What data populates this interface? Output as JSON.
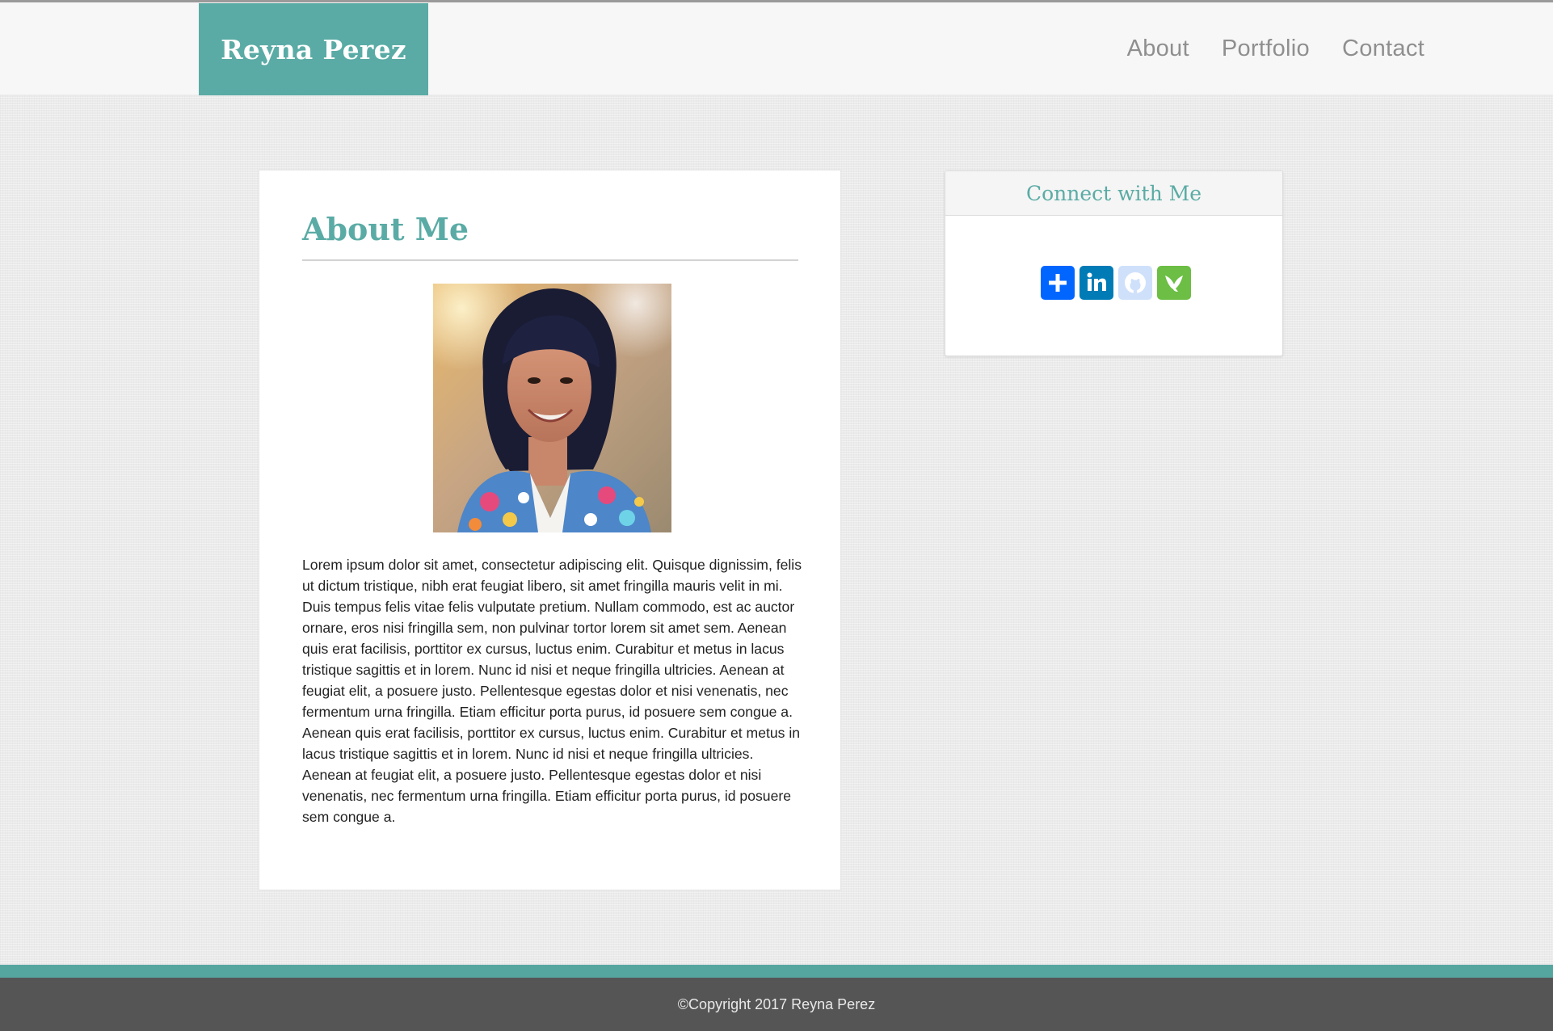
{
  "header": {
    "brand": "Reyna Perez",
    "nav": [
      {
        "label": "About"
      },
      {
        "label": "Portfolio"
      },
      {
        "label": "Contact"
      }
    ]
  },
  "about": {
    "title": "About Me",
    "photo": "portrait-photo",
    "text": "Lorem ipsum dolor sit amet, consectetur adipiscing elit. Quisque dignissim, felis ut dictum tristique, nibh erat feugiat libero, sit amet fringilla mauris velit in mi. Duis tempus felis vitae felis vulputate pretium. Nullam commodo, est ac auctor ornare, eros nisi fringilla sem, non pulvinar tortor lorem sit amet sem. Aenean quis erat facilisis, porttitor ex cursus, luctus enim. Curabitur et metus in lacus tristique sagittis et in lorem. Nunc id nisi et neque fringilla ultricies. Aenean at feugiat elit, a posuere justo. Pellentesque egestas dolor et nisi venenatis, nec fermentum urna fringilla. Etiam efficitur porta purus, id posuere sem congue a. Aenean quis erat facilisis, porttitor ex cursus, luctus enim. Curabitur et metus in lacus tristique sagittis et in lorem. Nunc id nisi et neque fringilla ultricies. Aenean at feugiat elit, a posuere justo. Pellentesque egestas dolor et nisi venenatis, nec fermentum urna fringilla. Etiam efficitur porta purus, id posuere sem congue a."
  },
  "connect": {
    "title": "Connect with Me",
    "icons": [
      "share-plus-icon",
      "linkedin-icon",
      "github-icon",
      "bird-icon"
    ]
  },
  "footer": {
    "copyright": "©Copyright 2017 Reyna Perez"
  },
  "colors": {
    "accent": "#5aaba5",
    "footer": "#555555",
    "nav_text": "#8f8f8f",
    "share": "#0166ff",
    "linkedin": "#007bb5",
    "github": "#cfe0fb",
    "bird": "#6cbe45"
  }
}
